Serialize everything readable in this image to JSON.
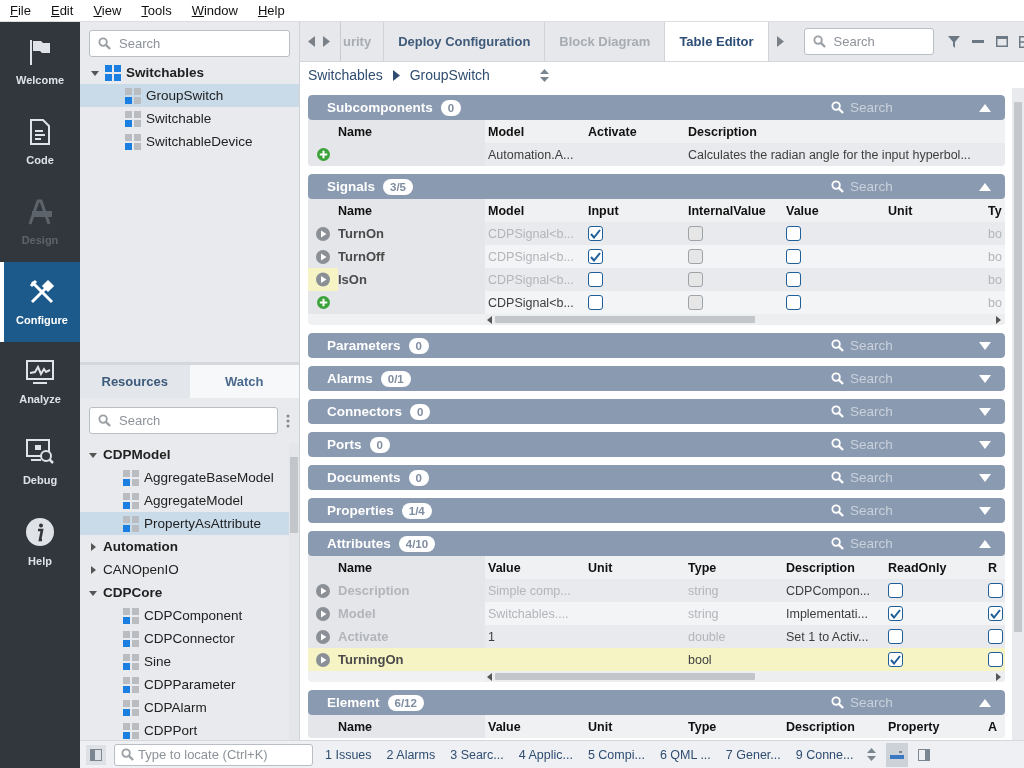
{
  "menu": [
    "File",
    "Edit",
    "View",
    "Tools",
    "Window",
    "Help"
  ],
  "activity_bar": [
    {
      "label": "Welcome",
      "selected": false,
      "disabled": false
    },
    {
      "label": "Code",
      "selected": false,
      "disabled": false
    },
    {
      "label": "Design",
      "selected": false,
      "disabled": true
    },
    {
      "label": "Configure",
      "selected": true,
      "disabled": false
    },
    {
      "label": "Analyze",
      "selected": false,
      "disabled": false
    },
    {
      "label": "Debug",
      "selected": false,
      "disabled": false
    },
    {
      "label": "Help",
      "selected": false,
      "disabled": false
    }
  ],
  "project_panel": {
    "search_placeholder": "Search",
    "tree": [
      {
        "label": "Switchables",
        "kind": "library",
        "bold": true,
        "expanded": true,
        "selected": false,
        "children": [
          {
            "label": "GroupSwitch",
            "kind": "component",
            "bold": false,
            "selected": true
          },
          {
            "label": "Switchable",
            "kind": "component",
            "bold": false,
            "selected": false
          },
          {
            "label": "SwitchableDevice",
            "kind": "component",
            "bold": false,
            "selected": false
          }
        ]
      }
    ]
  },
  "resource_panel": {
    "tabs": [
      {
        "label": "Resources",
        "selected": true
      },
      {
        "label": "Watch",
        "selected": false
      }
    ],
    "search_placeholder": "Search",
    "tree": [
      {
        "label": "CDPModel",
        "bold": true,
        "expanded": true,
        "selected": false,
        "children": [
          {
            "label": "AggregateBaseModel",
            "kind": "component",
            "bold": false,
            "selected": false
          },
          {
            "label": "AggregateModel",
            "kind": "component",
            "bold": false,
            "selected": false
          },
          {
            "label": "PropertyAsAttribute",
            "kind": "component",
            "bold": false,
            "selected": true
          }
        ]
      },
      {
        "label": "Automation",
        "bold": true,
        "expanded": false,
        "selected": false
      },
      {
        "label": "CANOpenIO",
        "bold": false,
        "expanded": false,
        "selected": false
      },
      {
        "label": "CDPCore",
        "bold": true,
        "expanded": true,
        "selected": false,
        "children": [
          {
            "label": "CDPComponent",
            "kind": "component",
            "bold": false,
            "selected": false
          },
          {
            "label": "CDPConnector",
            "kind": "component",
            "bold": false,
            "selected": false
          },
          {
            "label": "Sine",
            "kind": "component",
            "bold": false,
            "selected": false
          },
          {
            "label": "CDPParameter",
            "kind": "component",
            "bold": false,
            "selected": false
          },
          {
            "label": "CDPAlarm",
            "kind": "component",
            "bold": false,
            "selected": false
          },
          {
            "label": "CDPPort",
            "kind": "component",
            "bold": false,
            "selected": false
          }
        ]
      }
    ]
  },
  "editor_tabs": [
    {
      "label": "urity",
      "selected": false,
      "dimmed": true,
      "cut": true
    },
    {
      "label": "Deploy Configuration",
      "selected": false,
      "dimmed": false,
      "cut": false
    },
    {
      "label": "Block Diagram",
      "selected": false,
      "dimmed": true,
      "cut": false
    },
    {
      "label": "Table Editor",
      "selected": true,
      "dimmed": false,
      "cut": false
    }
  ],
  "editor_search_placeholder": "Search",
  "breadcrumb": [
    "Switchables",
    "GroupSwitch"
  ],
  "sections": [
    {
      "title": "Subcomponents",
      "badge": "0",
      "expanded": true,
      "search_placeholder": "Search",
      "columns": [
        "Name",
        "Model",
        "Activate",
        "Description"
      ],
      "rows": [
        {
          "kind": "add",
          "marker_highlighted": false,
          "highlighted": false,
          "cells": [
            {
              "kind": "name",
              "text": ""
            },
            {
              "kind": "text",
              "text": "Automation.A...",
              "dim": false
            },
            {
              "kind": "text",
              "text": ""
            },
            {
              "kind": "text",
              "text": "Calculates the radian angle for the input hyperbol...",
              "dim": false
            }
          ]
        }
      ]
    },
    {
      "title": "Signals",
      "badge": "3/5",
      "expanded": true,
      "search_placeholder": "Search",
      "columns": [
        "Name",
        "Model",
        "Input",
        "InternalValue",
        "Value",
        "Unit",
        "Ty"
      ],
      "rows": [
        {
          "kind": "play",
          "marker_highlighted": false,
          "highlighted": false,
          "cells": [
            {
              "kind": "name",
              "text": "TurnOn",
              "dim": false
            },
            {
              "kind": "text",
              "text": "CDPSignal<b...",
              "dim": true
            },
            {
              "kind": "check",
              "checked": true,
              "disabled": false
            },
            {
              "kind": "check",
              "checked": false,
              "disabled": true
            },
            {
              "kind": "check",
              "checked": false,
              "disabled": false
            },
            {
              "kind": "text",
              "text": ""
            },
            {
              "kind": "text",
              "text": "bo",
              "dim": true
            }
          ]
        },
        {
          "kind": "play",
          "marker_highlighted": false,
          "highlighted": false,
          "cells": [
            {
              "kind": "name",
              "text": "TurnOff",
              "dim": false
            },
            {
              "kind": "text",
              "text": "CDPSignal<b...",
              "dim": true
            },
            {
              "kind": "check",
              "checked": true,
              "disabled": false
            },
            {
              "kind": "check",
              "checked": false,
              "disabled": true
            },
            {
              "kind": "check",
              "checked": false,
              "disabled": false
            },
            {
              "kind": "text",
              "text": ""
            },
            {
              "kind": "text",
              "text": "bo",
              "dim": true
            }
          ]
        },
        {
          "kind": "play",
          "marker_highlighted": true,
          "highlighted": false,
          "cells": [
            {
              "kind": "name",
              "text": "IsOn",
              "dim": false
            },
            {
              "kind": "text",
              "text": "CDPSignal<b...",
              "dim": true
            },
            {
              "kind": "check",
              "checked": false,
              "disabled": false
            },
            {
              "kind": "check",
              "checked": false,
              "disabled": true
            },
            {
              "kind": "check",
              "checked": false,
              "disabled": false
            },
            {
              "kind": "text",
              "text": ""
            },
            {
              "kind": "text",
              "text": "bo",
              "dim": true
            }
          ]
        },
        {
          "kind": "add",
          "marker_highlighted": false,
          "highlighted": false,
          "cells": [
            {
              "kind": "name",
              "text": ""
            },
            {
              "kind": "text",
              "text": "CDPSignal<b...",
              "dim": false
            },
            {
              "kind": "check",
              "checked": false,
              "disabled": false
            },
            {
              "kind": "check",
              "checked": false,
              "disabled": true
            },
            {
              "kind": "check",
              "checked": false,
              "disabled": false
            },
            {
              "kind": "text",
              "text": ""
            },
            {
              "kind": "text",
              "text": "bo",
              "dim": true
            }
          ]
        }
      ]
    },
    {
      "title": "Parameters",
      "badge": "0",
      "expanded": false,
      "search_placeholder": "Search"
    },
    {
      "title": "Alarms",
      "badge": "0/1",
      "expanded": false,
      "search_placeholder": "Search"
    },
    {
      "title": "Connectors",
      "badge": "0",
      "expanded": false,
      "search_placeholder": "Search"
    },
    {
      "title": "Ports",
      "badge": "0",
      "expanded": false,
      "search_placeholder": "Search"
    },
    {
      "title": "Documents",
      "badge": "0",
      "expanded": false,
      "search_placeholder": "Search"
    },
    {
      "title": "Properties",
      "badge": "1/4",
      "expanded": false,
      "search_placeholder": "Search"
    },
    {
      "title": "Attributes",
      "badge": "4/10",
      "expanded": true,
      "search_placeholder": "Search",
      "columns": [
        "Name",
        "Value",
        "Unit",
        "Type",
        "Description",
        "ReadOnly",
        "R"
      ],
      "rows": [
        {
          "kind": "play",
          "marker_highlighted": false,
          "highlighted": false,
          "cells": [
            {
              "kind": "name",
              "text": "Description",
              "dim": true
            },
            {
              "kind": "text",
              "text": "Simple comp...",
              "dim": true
            },
            {
              "kind": "text",
              "text": ""
            },
            {
              "kind": "text",
              "text": "string",
              "dim": true
            },
            {
              "kind": "text",
              "text": "CDPCompon...",
              "dim": false
            },
            {
              "kind": "check",
              "checked": false,
              "disabled": false
            },
            {
              "kind": "check",
              "checked": false,
              "disabled": false
            }
          ]
        },
        {
          "kind": "play",
          "marker_highlighted": false,
          "highlighted": false,
          "cells": [
            {
              "kind": "name",
              "text": "Model",
              "dim": true
            },
            {
              "kind": "text",
              "text": "Switchables....",
              "dim": true
            },
            {
              "kind": "text",
              "text": ""
            },
            {
              "kind": "text",
              "text": "string",
              "dim": true
            },
            {
              "kind": "text",
              "text": "Implementati...",
              "dim": false
            },
            {
              "kind": "check",
              "checked": true,
              "disabled": false
            },
            {
              "kind": "check",
              "checked": true,
              "disabled": false
            }
          ]
        },
        {
          "kind": "play",
          "marker_highlighted": false,
          "highlighted": false,
          "cells": [
            {
              "kind": "name",
              "text": "Activate",
              "dim": true
            },
            {
              "kind": "text",
              "text": "1",
              "dim": false
            },
            {
              "kind": "text",
              "text": ""
            },
            {
              "kind": "text",
              "text": "double",
              "dim": true
            },
            {
              "kind": "text",
              "text": "Set 1 to Activ...",
              "dim": false
            },
            {
              "kind": "check",
              "checked": false,
              "disabled": false
            },
            {
              "kind": "check",
              "checked": false,
              "disabled": false
            }
          ]
        },
        {
          "kind": "play",
          "marker_highlighted": false,
          "highlighted": true,
          "cells": [
            {
              "kind": "name",
              "text": "TurningOn",
              "dim": false
            },
            {
              "kind": "text",
              "text": ""
            },
            {
              "kind": "text",
              "text": ""
            },
            {
              "kind": "text",
              "text": "bool",
              "dim": false
            },
            {
              "kind": "text",
              "text": ""
            },
            {
              "kind": "check",
              "checked": true,
              "disabled": false
            },
            {
              "kind": "check",
              "checked": false,
              "disabled": false
            }
          ]
        }
      ]
    },
    {
      "title": "Element",
      "badge": "6/12",
      "expanded": true,
      "search_placeholder": "Search",
      "columns": [
        "Name",
        "Value",
        "Unit",
        "Type",
        "Description",
        "Property",
        "A"
      ]
    }
  ],
  "status_bar": {
    "locate_placeholder": "Type to locate (Ctrl+K)",
    "items": [
      "1 Issues",
      "2 Alarms",
      "3 Searc...",
      "4 Applic...",
      "5 Compi...",
      "6 QML ...",
      "7 Gener...",
      "9 Conne..."
    ]
  }
}
